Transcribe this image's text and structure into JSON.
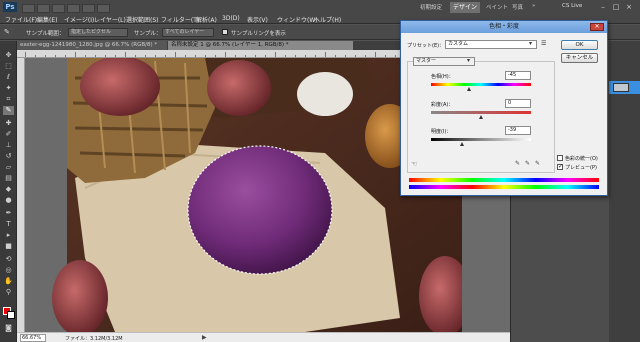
{
  "app": {
    "logo": "Ps",
    "menus": [
      "ファイル(F)",
      "編集(E)",
      "イメージ(I)",
      "レイヤー(L)",
      "選択範囲(S)",
      "フィルター(T)",
      "解析(A)",
      "3D(D)",
      "表示(V)",
      "ウィンドウ(W)",
      "ヘルプ(H)"
    ],
    "workspace": {
      "links": [
        "初期設定",
        "デザイン",
        "ペイント",
        "写真"
      ],
      "active_tab": "デザイン",
      "more": "»"
    },
    "cslive": "CS Live"
  },
  "options": {
    "sample_size_label": "サンプル範囲：",
    "sample_size_value": "指定したピクセル",
    "sample_label": "サンプル：",
    "sample_value": "すべてのレイヤー",
    "show_ring_label": "サンプルリングを表示"
  },
  "tabs": [
    {
      "label": "easter-egg-1241980_1280.jpg @ 66.7% (RGB/8) *",
      "active": false
    },
    {
      "label": "名称未設定 1 @ 66.7% (レイヤー 1, RGB/8) *",
      "active": true
    }
  ],
  "status": {
    "zoom": "66.67%",
    "file_info": "ファイル：3.12M/3.12M",
    "arrow": "▶"
  },
  "dialog": {
    "title": "色相・彩度",
    "close": "✕",
    "preset_label": "プリセット(E)：",
    "preset_value": "カスタム",
    "channel_value": "マスター",
    "hue_label": "色相(H)：",
    "hue_value": "-45",
    "saturation_label": "彩度(A)：",
    "saturation_value": "0",
    "lightness_label": "明度(I)：",
    "lightness_value": "-39",
    "ok_label": "OK",
    "cancel_label": "キャンセル",
    "colorize_label": "色彩の統一(O)",
    "preview_label": "プレビュー(P)",
    "colorize_checked": false,
    "preview_checked": true,
    "hue_slider": 0.375,
    "saturation_slider": 0.5,
    "lightness_slider": 0.305
  }
}
